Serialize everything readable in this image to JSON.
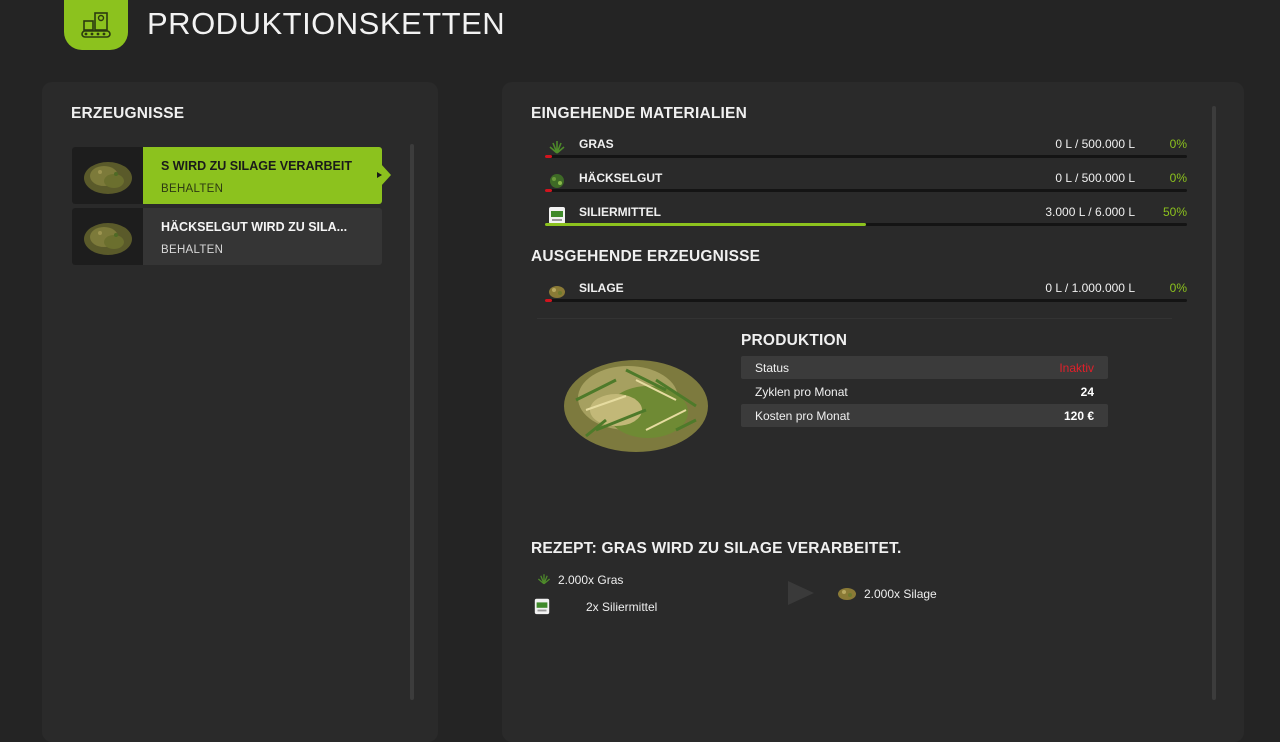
{
  "header": {
    "title": "PRODUKTIONSKETTEN",
    "icon": "production-chain-icon",
    "accent": "#8cc21e"
  },
  "left_panel": {
    "title": "ERZEUGNISSE",
    "items": [
      {
        "title": "S WIRD ZU SILAGE VERARBEIT",
        "sub": "BEHALTEN",
        "selected": true
      },
      {
        "title": "HÄCKSELGUT WIRD ZU SILA...",
        "sub": "BEHALTEN",
        "selected": false
      }
    ]
  },
  "incoming": {
    "title": "EINGEHENDE MATERIALIEN",
    "items": [
      {
        "name": "GRAS",
        "amount": "0 L / 500.000 L",
        "pct": "0%",
        "fill": 0,
        "icon": "grass-icon"
      },
      {
        "name": "HÄCKSELGUT",
        "amount": "0 L / 500.000 L",
        "pct": "0%",
        "fill": 0,
        "icon": "chaff-icon"
      },
      {
        "name": "SILIERMITTEL",
        "amount": "3.000 L / 6.000 L",
        "pct": "50%",
        "fill": 0.5,
        "icon": "silage-additive-icon"
      }
    ]
  },
  "outgoing": {
    "title": "AUSGEHENDE ERZEUGNISSE",
    "items": [
      {
        "name": "SILAGE",
        "amount": "0 L / 1.000.000 L",
        "pct": "0%",
        "fill": 0,
        "icon": "silage-icon"
      }
    ]
  },
  "production": {
    "title": "PRODUKTION",
    "rows": [
      {
        "label": "Status",
        "value": "Inaktiv",
        "color": "#e0202a"
      },
      {
        "label": "Zyklen pro Monat",
        "value": "24"
      },
      {
        "label": "Kosten pro Monat",
        "value": "120 €"
      }
    ]
  },
  "recipe": {
    "title": "REZEPT: GRAS WIRD ZU SILAGE VERARBEITET.",
    "inputs": [
      "2.000x Gras",
      "2x Siliermittel"
    ],
    "output": "2.000x Silage"
  }
}
